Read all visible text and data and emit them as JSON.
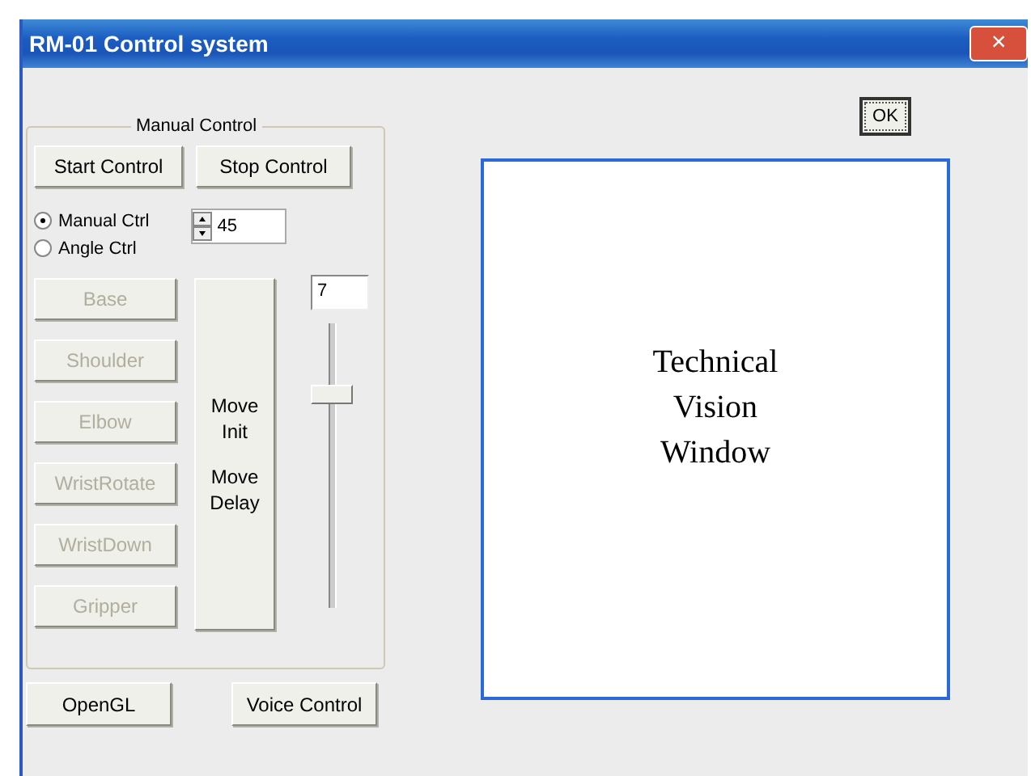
{
  "window": {
    "title": "RM-01 Control system",
    "close": "×"
  },
  "ok_button": "OK",
  "manual_control": {
    "title": "Manual Control",
    "buttons": [
      "Start Control",
      "Stop Control"
    ],
    "modes": [
      {
        "label": "Manual Ctrl",
        "selected": true
      },
      {
        "label": "Angle Ctrl",
        "selected": false
      }
    ],
    "spinner_value": "45",
    "joints": [
      {
        "label": "Base",
        "disabled": true
      },
      {
        "label": "Shoulder",
        "disabled": true
      },
      {
        "label": "Elbow",
        "disabled": true
      },
      {
        "label": "WristRotate",
        "disabled": true
      },
      {
        "label": "WristDown",
        "disabled": true
      },
      {
        "label": "Gripper",
        "disabled": true
      }
    ],
    "move_button": {
      "line1": "Move",
      "line2": "Init",
      "line3": "Move",
      "line4": "Delay"
    },
    "delay_value": "7",
    "slider": {
      "level": 0.77
    }
  },
  "bottom_buttons": [
    "OpenGL",
    "Voice Control"
  ],
  "vision": {
    "line1": "Technical",
    "line2": "Vision",
    "line3": "Window"
  }
}
